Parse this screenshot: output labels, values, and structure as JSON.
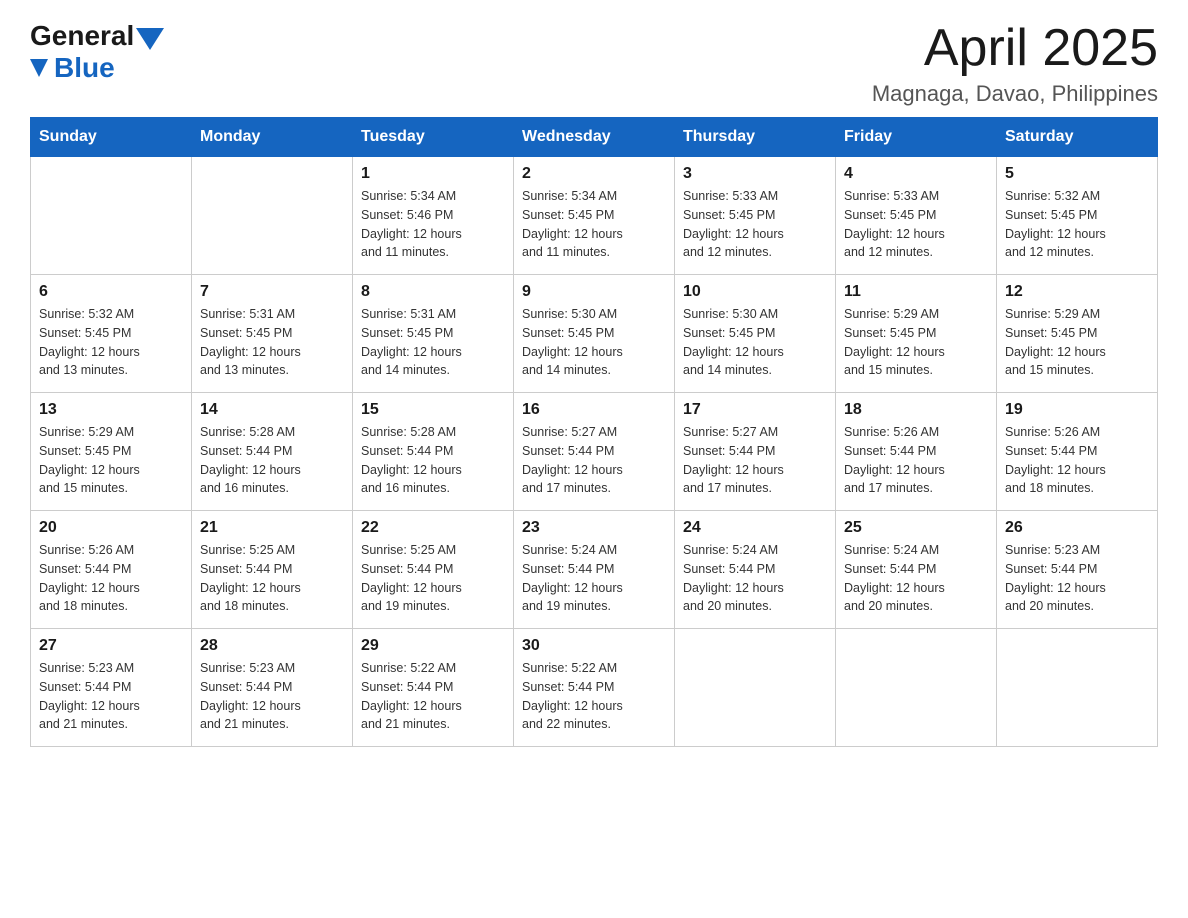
{
  "logo": {
    "general": "General",
    "blue": "Blue"
  },
  "title": {
    "month_year": "April 2025",
    "location": "Magnaga, Davao, Philippines"
  },
  "weekdays": [
    "Sunday",
    "Monday",
    "Tuesday",
    "Wednesday",
    "Thursday",
    "Friday",
    "Saturday"
  ],
  "weeks": [
    [
      {
        "day": "",
        "info": ""
      },
      {
        "day": "",
        "info": ""
      },
      {
        "day": "1",
        "info": "Sunrise: 5:34 AM\nSunset: 5:46 PM\nDaylight: 12 hours\nand 11 minutes."
      },
      {
        "day": "2",
        "info": "Sunrise: 5:34 AM\nSunset: 5:45 PM\nDaylight: 12 hours\nand 11 minutes."
      },
      {
        "day": "3",
        "info": "Sunrise: 5:33 AM\nSunset: 5:45 PM\nDaylight: 12 hours\nand 12 minutes."
      },
      {
        "day": "4",
        "info": "Sunrise: 5:33 AM\nSunset: 5:45 PM\nDaylight: 12 hours\nand 12 minutes."
      },
      {
        "day": "5",
        "info": "Sunrise: 5:32 AM\nSunset: 5:45 PM\nDaylight: 12 hours\nand 12 minutes."
      }
    ],
    [
      {
        "day": "6",
        "info": "Sunrise: 5:32 AM\nSunset: 5:45 PM\nDaylight: 12 hours\nand 13 minutes."
      },
      {
        "day": "7",
        "info": "Sunrise: 5:31 AM\nSunset: 5:45 PM\nDaylight: 12 hours\nand 13 minutes."
      },
      {
        "day": "8",
        "info": "Sunrise: 5:31 AM\nSunset: 5:45 PM\nDaylight: 12 hours\nand 14 minutes."
      },
      {
        "day": "9",
        "info": "Sunrise: 5:30 AM\nSunset: 5:45 PM\nDaylight: 12 hours\nand 14 minutes."
      },
      {
        "day": "10",
        "info": "Sunrise: 5:30 AM\nSunset: 5:45 PM\nDaylight: 12 hours\nand 14 minutes."
      },
      {
        "day": "11",
        "info": "Sunrise: 5:29 AM\nSunset: 5:45 PM\nDaylight: 12 hours\nand 15 minutes."
      },
      {
        "day": "12",
        "info": "Sunrise: 5:29 AM\nSunset: 5:45 PM\nDaylight: 12 hours\nand 15 minutes."
      }
    ],
    [
      {
        "day": "13",
        "info": "Sunrise: 5:29 AM\nSunset: 5:45 PM\nDaylight: 12 hours\nand 15 minutes."
      },
      {
        "day": "14",
        "info": "Sunrise: 5:28 AM\nSunset: 5:44 PM\nDaylight: 12 hours\nand 16 minutes."
      },
      {
        "day": "15",
        "info": "Sunrise: 5:28 AM\nSunset: 5:44 PM\nDaylight: 12 hours\nand 16 minutes."
      },
      {
        "day": "16",
        "info": "Sunrise: 5:27 AM\nSunset: 5:44 PM\nDaylight: 12 hours\nand 17 minutes."
      },
      {
        "day": "17",
        "info": "Sunrise: 5:27 AM\nSunset: 5:44 PM\nDaylight: 12 hours\nand 17 minutes."
      },
      {
        "day": "18",
        "info": "Sunrise: 5:26 AM\nSunset: 5:44 PM\nDaylight: 12 hours\nand 17 minutes."
      },
      {
        "day": "19",
        "info": "Sunrise: 5:26 AM\nSunset: 5:44 PM\nDaylight: 12 hours\nand 18 minutes."
      }
    ],
    [
      {
        "day": "20",
        "info": "Sunrise: 5:26 AM\nSunset: 5:44 PM\nDaylight: 12 hours\nand 18 minutes."
      },
      {
        "day": "21",
        "info": "Sunrise: 5:25 AM\nSunset: 5:44 PM\nDaylight: 12 hours\nand 18 minutes."
      },
      {
        "day": "22",
        "info": "Sunrise: 5:25 AM\nSunset: 5:44 PM\nDaylight: 12 hours\nand 19 minutes."
      },
      {
        "day": "23",
        "info": "Sunrise: 5:24 AM\nSunset: 5:44 PM\nDaylight: 12 hours\nand 19 minutes."
      },
      {
        "day": "24",
        "info": "Sunrise: 5:24 AM\nSunset: 5:44 PM\nDaylight: 12 hours\nand 20 minutes."
      },
      {
        "day": "25",
        "info": "Sunrise: 5:24 AM\nSunset: 5:44 PM\nDaylight: 12 hours\nand 20 minutes."
      },
      {
        "day": "26",
        "info": "Sunrise: 5:23 AM\nSunset: 5:44 PM\nDaylight: 12 hours\nand 20 minutes."
      }
    ],
    [
      {
        "day": "27",
        "info": "Sunrise: 5:23 AM\nSunset: 5:44 PM\nDaylight: 12 hours\nand 21 minutes."
      },
      {
        "day": "28",
        "info": "Sunrise: 5:23 AM\nSunset: 5:44 PM\nDaylight: 12 hours\nand 21 minutes."
      },
      {
        "day": "29",
        "info": "Sunrise: 5:22 AM\nSunset: 5:44 PM\nDaylight: 12 hours\nand 21 minutes."
      },
      {
        "day": "30",
        "info": "Sunrise: 5:22 AM\nSunset: 5:44 PM\nDaylight: 12 hours\nand 22 minutes."
      },
      {
        "day": "",
        "info": ""
      },
      {
        "day": "",
        "info": ""
      },
      {
        "day": "",
        "info": ""
      }
    ]
  ]
}
